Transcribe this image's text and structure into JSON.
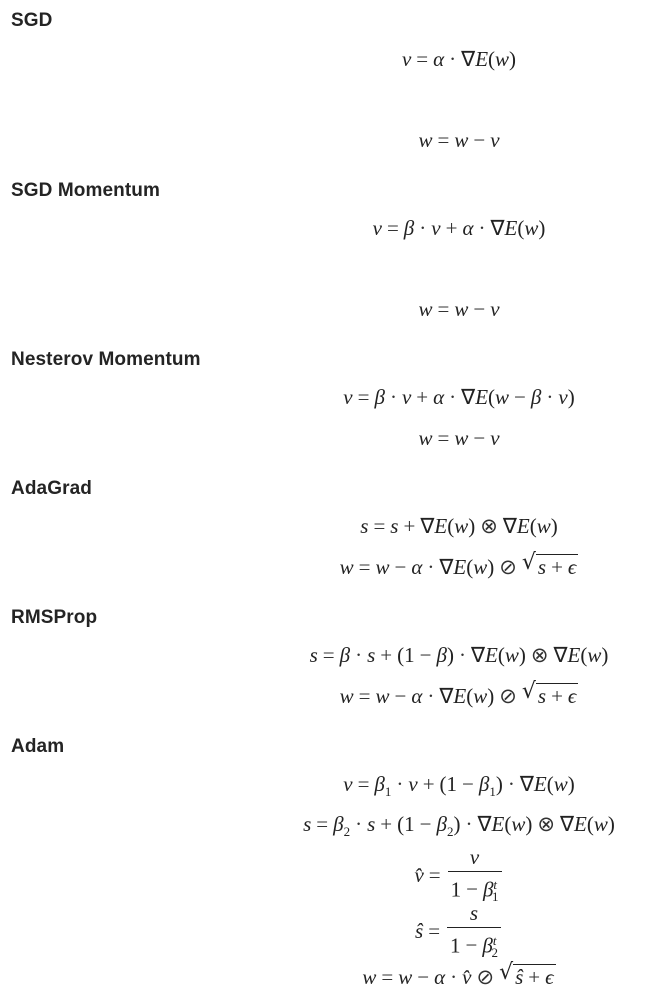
{
  "sections": [
    {
      "heading": "SGD",
      "equations": [
        "v = α · ∇E(w)",
        "w = w − v"
      ]
    },
    {
      "heading": "SGD Momentum",
      "equations": [
        "v = β · v + α · ∇E(w)",
        "w = w − v"
      ]
    },
    {
      "heading": "Nesterov Momentum",
      "equations": [
        "v = β · v + α · ∇E(w − β · v)",
        "w = w − v"
      ]
    },
    {
      "heading": "AdaGrad",
      "equations": [
        "s = s + ∇E(w) ⊗ ∇E(w)",
        "w = w − α · ∇E(w) ⊘ √(s + ϵ)"
      ]
    },
    {
      "heading": "RMSProp",
      "equations": [
        "s = β · s + (1 − β) · ∇E(w) ⊗ ∇E(w)",
        "w = w − α · ∇E(w) ⊘ √(s + ϵ)"
      ]
    },
    {
      "heading": "Adam",
      "equations": [
        "v = β1 · v + (1 − β1) · ∇E(w)",
        "s = β2 · s + (1 − β2) · ∇E(w) ⊗ ∇E(w)",
        "v̂ = v / (1 − β1^t)",
        "ŝ = s / (1 − β2^t)",
        "w = w − α · v̂ ⊘ √(ŝ + ϵ)"
      ]
    }
  ],
  "glyphs": {
    "v": "v",
    "w": "w",
    "s": "s",
    "E": "E",
    "alpha": "α",
    "beta": "β",
    "epsilon": "ϵ",
    "nabla": "∇",
    "eq": "=",
    "cdot": "·",
    "plus": "+",
    "minus": "−",
    "otimes": "⊗",
    "oslash": "⊘",
    "lparen": "(",
    "rparen": ")",
    "one": "1",
    "sub1": "1",
    "sub2": "2",
    "supt": "t",
    "sqrt": "√",
    "vhat": "v̂",
    "shat": "ŝ"
  }
}
